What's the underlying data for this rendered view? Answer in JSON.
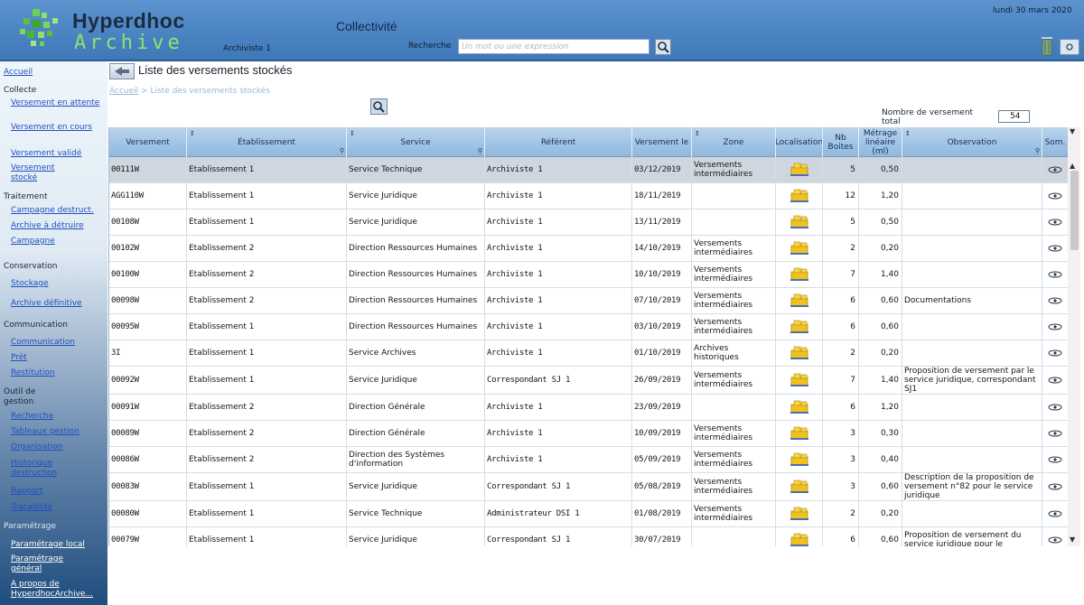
{
  "header": {
    "logo_line1": "Hyperdhoc",
    "logo_line2": "Archive",
    "user": "Archiviste 1",
    "collectivite": "Collectivité",
    "search_label": "Recherche",
    "search_placeholder": "Un mot ou une expression",
    "date": "lundi 30 mars 2020",
    "brand_green": "#8fe26e",
    "header_blue": "#4a84c4"
  },
  "sidebar": {
    "home": "Accueil",
    "sections": [
      {
        "title": "Collecte",
        "items": [
          "Versement en attente",
          "Versement en cours",
          "Versement validé",
          "Versement stocké"
        ]
      },
      {
        "title": "Traitement",
        "items": [
          "Campagne destruct.",
          "Archive à détruire",
          "Campagne"
        ]
      },
      {
        "title": "Conservation",
        "items": [
          "Stockage",
          "Archive définitive"
        ]
      },
      {
        "title": "Communication",
        "items": [
          "Communication",
          "Prêt",
          "Restitution"
        ]
      },
      {
        "title": "Outil de gestion",
        "items": [
          "Recherche",
          "Tableaux gestion",
          "Organisation",
          "Historique destruction",
          "Rapport",
          "Traçabilité"
        ]
      },
      {
        "title": "Paramétrage",
        "items": [
          "Paramétrage local",
          "Paramétrage général",
          "A propos de HyperdhocArchive..."
        ]
      }
    ]
  },
  "page": {
    "title": "Liste des versements stockés",
    "breadcrumb_home": "Accueil",
    "breadcrumb_sep": ">",
    "breadcrumb_current": "Liste des versements stockés",
    "count_label": "Nombre de versement total",
    "count_value": "54"
  },
  "table": {
    "columns": [
      "Versement",
      "Établissement",
      "Service",
      "Référent",
      "Versement le",
      "Zone",
      "Localisation",
      "Nb Boites",
      "Métrage linéaire (ml)",
      "Observation",
      "Som."
    ],
    "rows": [
      {
        "versement": "00111W",
        "etab": "Etablissement 1",
        "service": "Service Technique",
        "referent": "Archiviste 1",
        "date": "03/12/2019",
        "zone": "Versements intermédiaires",
        "nb": "5",
        "metrage": "0,50",
        "obs": ""
      },
      {
        "versement": "AGG110W",
        "etab": "Etablissement 1",
        "service": "Service Juridique",
        "referent": "Archiviste 1",
        "date": "18/11/2019",
        "zone": "",
        "nb": "12",
        "metrage": "1,20",
        "obs": ""
      },
      {
        "versement": "00108W",
        "etab": "Etablissement 1",
        "service": "Service Juridique",
        "referent": "Archiviste 1",
        "date": "13/11/2019",
        "zone": "",
        "nb": "5",
        "metrage": "0,50",
        "obs": ""
      },
      {
        "versement": "00102W",
        "etab": "Etablissement 2",
        "service": "Direction Ressources Humaines",
        "referent": "Archiviste 1",
        "date": "14/10/2019",
        "zone": "Versements intermédiaires",
        "nb": "2",
        "metrage": "0,20",
        "obs": ""
      },
      {
        "versement": "00100W",
        "etab": "Etablissement 2",
        "service": "Direction Ressources Humaines",
        "referent": "Archiviste 1",
        "date": "10/10/2019",
        "zone": "Versements intermédiaires",
        "nb": "7",
        "metrage": "1,40",
        "obs": ""
      },
      {
        "versement": "00098W",
        "etab": "Etablissement 2",
        "service": "Direction Ressources Humaines",
        "referent": "Archiviste 1",
        "date": "07/10/2019",
        "zone": "Versements intermédiaires",
        "nb": "6",
        "metrage": "0,60",
        "obs": "Documentations"
      },
      {
        "versement": "00095W",
        "etab": "Etablissement 1",
        "service": "Direction Ressources Humaines",
        "referent": "Archiviste 1",
        "date": "03/10/2019",
        "zone": "Versements intermédiaires",
        "nb": "6",
        "metrage": "0,60",
        "obs": ""
      },
      {
        "versement": "3I",
        "etab": "Etablissement 1",
        "service": "Service Archives",
        "referent": "Archiviste 1",
        "date": "01/10/2019",
        "zone": "Archives historiques",
        "nb": "2",
        "metrage": "0,20",
        "obs": ""
      },
      {
        "versement": "00092W",
        "etab": "Etablissement 1",
        "service": "Service Juridique",
        "referent": "Correspondant SJ 1",
        "date": "26/09/2019",
        "zone": "Versements intermédiaires",
        "nb": "7",
        "metrage": "1,40",
        "obs": "Proposition de versement par le service juridique, correspondant SJ1"
      },
      {
        "versement": "00091W",
        "etab": "Etablissement 2",
        "service": "Direction Générale",
        "referent": "Archiviste 1",
        "date": "23/09/2019",
        "zone": "",
        "nb": "6",
        "metrage": "1,20",
        "obs": ""
      },
      {
        "versement": "00089W",
        "etab": "Etablissement 2",
        "service": "Direction Générale",
        "referent": "Archiviste 1",
        "date": "10/09/2019",
        "zone": "Versements intermédiaires",
        "nb": "3",
        "metrage": "0,30",
        "obs": ""
      },
      {
        "versement": "00086W",
        "etab": "Etablissement 2",
        "service": "Direction des Systèmes d'information",
        "referent": "Archiviste 1",
        "date": "05/09/2019",
        "zone": "Versements intermédiaires",
        "nb": "3",
        "metrage": "0,40",
        "obs": ""
      },
      {
        "versement": "00083W",
        "etab": "Etablissement 1",
        "service": "Service Juridique",
        "referent": "Correspondant SJ 1",
        "date": "05/08/2019",
        "zone": "Versements intermédiaires",
        "nb": "3",
        "metrage": "0,60",
        "obs": "Description de la proposition de versement n°82 pour le service juridique"
      },
      {
        "versement": "00080W",
        "etab": "Etablissement 1",
        "service": "Service Technique",
        "referent": "Administrateur DSI 1",
        "date": "01/08/2019",
        "zone": "Versements intermédiaires",
        "nb": "2",
        "metrage": "0,20",
        "obs": ""
      },
      {
        "versement": "00079W",
        "etab": "Etablissement 1",
        "service": "Service Juridique",
        "referent": "Correspondant SJ 1",
        "date": "30/07/2019",
        "zone": "",
        "nb": "6",
        "metrage": "0,60",
        "obs": "Proposition de versement du service juridique pour le"
      }
    ]
  }
}
